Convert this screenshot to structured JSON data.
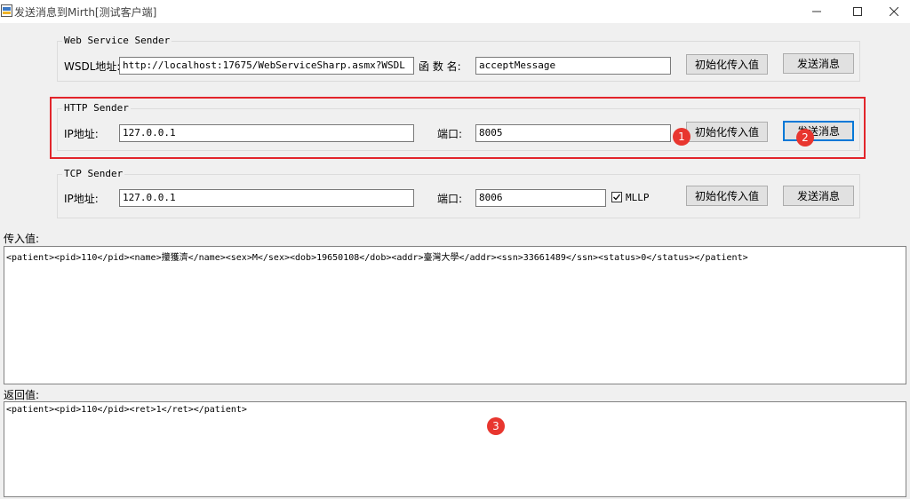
{
  "window": {
    "title": "发送消息到Mirth[测试客户端]",
    "minimize": "—",
    "maximize": "☐",
    "close": "✕"
  },
  "ws": {
    "legend": "Web  Service Sender",
    "wsdl_label": "WSDL地址:",
    "wsdl_value": "http://localhost:17675/WebServiceSharp.asmx?WSDL",
    "func_label": "函 数 名:",
    "func_value": "acceptMessage",
    "init_button": "初始化传入值",
    "send_button": "发送消息"
  },
  "http": {
    "legend": "HTTP Sender",
    "ip_label": "IP地址:",
    "ip_value": "127.0.0.1",
    "port_label": "端口:",
    "port_value": "8005",
    "init_button": "初始化传入值",
    "send_button": "发送消息"
  },
  "tcp": {
    "legend": "TCP Sender",
    "ip_label": "IP地址:",
    "ip_value": "127.0.0.1",
    "port_label": "端口:",
    "port_value": "8006",
    "mllp_label": "MLLP",
    "mllp_checked": true,
    "init_button": "初始化传入值",
    "send_button": "发送消息"
  },
  "input": {
    "label": "传入值:",
    "value": "<patient><pid>110</pid><name>攥獲濟</name><sex>M</sex><dob>19650108</dob><addr>臺灣大學</addr><ssn>33661489</ssn><status>0</status></patient>"
  },
  "output": {
    "label": "返回值:",
    "value": "<patient><pid>110</pid><ret>1</ret></patient>"
  },
  "annotations": {
    "marker1": "1",
    "marker2": "2",
    "marker3": "3",
    "highlight_color": "#e2252b",
    "marker_color": "#e8362f"
  }
}
